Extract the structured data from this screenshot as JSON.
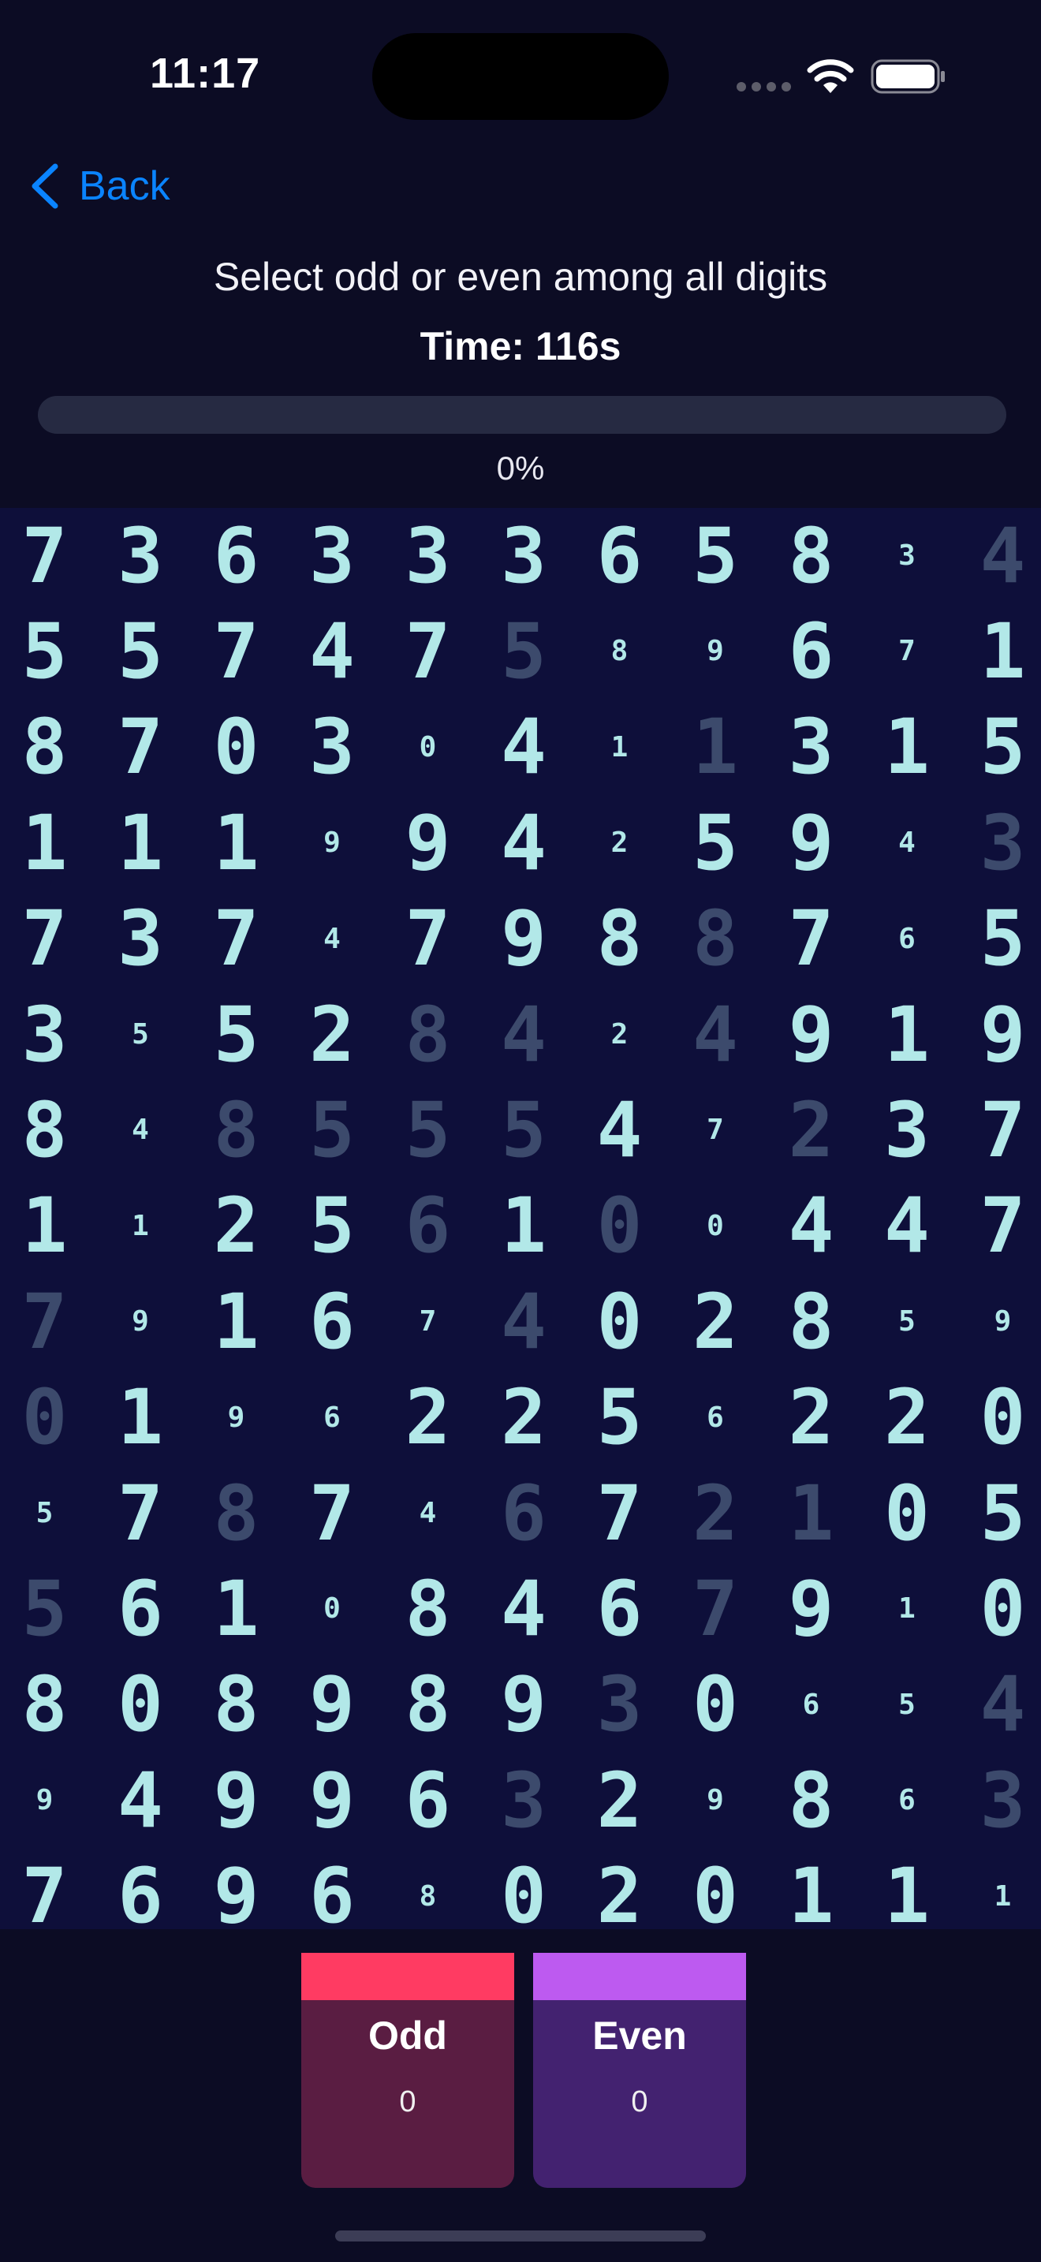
{
  "status": {
    "time": "11:17"
  },
  "nav": {
    "back_label": "Back"
  },
  "game": {
    "instruction": "Select odd or even among all digits",
    "timer": "Time: 116s",
    "progress_label": "0%",
    "progress_fraction": 0
  },
  "grid": [
    [
      "7L",
      "3L",
      "6L",
      "3L",
      "3L",
      "3L",
      "6L",
      "5L",
      "8L",
      "3s",
      "4D"
    ],
    [
      "5L",
      "5L",
      "7L",
      "4L",
      "7L",
      "5D",
      "8s",
      "9s",
      "6L",
      "7s",
      "1L"
    ],
    [
      "8L",
      "7L",
      "0L",
      "3L",
      "0s",
      "4L",
      "1s",
      "1D",
      "3L",
      "1L",
      "5L"
    ],
    [
      "1L",
      "1L",
      "1L",
      "9s",
      "9L",
      "4L",
      "2s",
      "5L",
      "9L",
      "4s",
      "3D"
    ],
    [
      "7L",
      "3L",
      "7L",
      "4s",
      "7L",
      "9L",
      "8L",
      "8D",
      "7L",
      "6s",
      "5L"
    ],
    [
      "3L",
      "5s",
      "5L",
      "2L",
      "8D",
      "4D",
      "2s",
      "4D",
      "9L",
      "1L",
      "9L"
    ],
    [
      "8L",
      "4s",
      "8D",
      "5D",
      "5D",
      "5D",
      "4L",
      "7s",
      "2D",
      "3L",
      "7L"
    ],
    [
      "1L",
      "1s",
      "2L",
      "5L",
      "6D",
      "1L",
      "0D",
      "0s",
      "4L",
      "4L",
      "7L"
    ],
    [
      "7D",
      "9s",
      "1L",
      "6L",
      "7s",
      "4D",
      "0L",
      "2L",
      "8L",
      "5s",
      "9s"
    ],
    [
      "0D",
      "1L",
      "9s",
      "6s",
      "2L",
      "2L",
      "5L",
      "6s",
      "2L",
      "2L",
      "0L"
    ],
    [
      "5s",
      "7L",
      "8D",
      "7L",
      "4s",
      "6D",
      "7L",
      "2D",
      "1D",
      "0L",
      "5L"
    ],
    [
      "5D",
      "6L",
      "1L",
      "0s",
      "8L",
      "4L",
      "6L",
      "7D",
      "9L",
      "1s",
      "0L"
    ],
    [
      "8L",
      "0L",
      "8L",
      "9L",
      "8L",
      "9L",
      "3D",
      "0L",
      "6s",
      "5s",
      "4D"
    ],
    [
      "9s",
      "4L",
      "9L",
      "9L",
      "6L",
      "3D",
      "2L",
      "9s",
      "8L",
      "6s",
      "3D"
    ],
    [
      "7L",
      "6L",
      "9L",
      "6L",
      "8s",
      "0L",
      "2L",
      "0L",
      "1L",
      "1L",
      "1s"
    ]
  ],
  "buttons": {
    "odd": {
      "label": "Odd",
      "count": "0",
      "color": "#ff3b62"
    },
    "even": {
      "label": "Even",
      "count": "0",
      "color": "#bd5af0"
    }
  },
  "colors": {
    "background": "#0c0c24",
    "grid_bg": "#0e0f3a",
    "digit": "#b2e8e8",
    "digit_dim": "#3c4a6c",
    "accent": "#0a84ff"
  }
}
